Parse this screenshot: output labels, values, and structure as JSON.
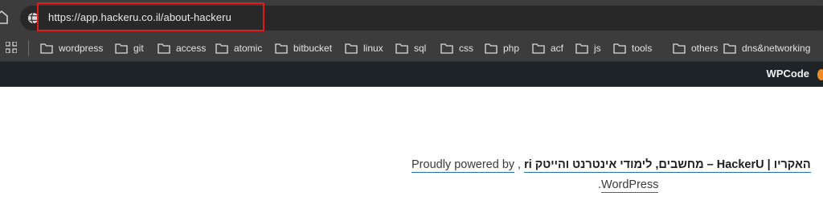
{
  "browser": {
    "url": "https://app.hackeru.co.il/about-hackeru",
    "highlight_color": "#e21a1a"
  },
  "bookmarks": [
    {
      "label": "wordpress",
      "icon": "folder-icon"
    },
    {
      "label": "git",
      "icon": "folder-icon"
    },
    {
      "label": "access",
      "icon": "folder-icon"
    },
    {
      "label": "atomic",
      "icon": "folder-icon"
    },
    {
      "label": "bitbucket",
      "icon": "folder-icon"
    },
    {
      "label": "linux",
      "icon": "folder-icon"
    },
    {
      "label": "sql",
      "icon": "folder-icon"
    },
    {
      "label": "css",
      "icon": "folder-icon"
    },
    {
      "label": "php",
      "icon": "folder-icon"
    },
    {
      "label": "acf",
      "icon": "folder-icon"
    },
    {
      "label": "js",
      "icon": "folder-icon"
    },
    {
      "label": "tools",
      "icon": "folder-icon"
    },
    {
      "label": "others",
      "icon": "folder-icon"
    },
    {
      "label": "dns&networking",
      "icon": "folder-icon"
    }
  ],
  "admin_bar": {
    "wpcode_label": "WPCode",
    "accent": "#f08a24"
  },
  "footer": {
    "powered_prefix": "Proudly powered by",
    "site_link": "ri מחשבים, לימודי אינטרנט והייטק – HackerU | האקריו",
    "comma": ",",
    "wordpress_link": "WordPress",
    "period": "."
  }
}
